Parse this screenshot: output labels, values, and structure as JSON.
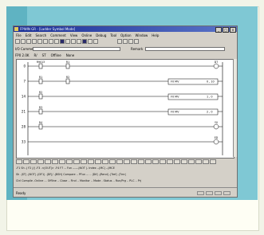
{
  "window": {
    "title": "FPWIN GR - [Ladder Symbol Mode]",
    "controls": [
      "_",
      "□",
      "×"
    ]
  },
  "menu": [
    "File",
    "Edit",
    "Search",
    "Comment",
    "View",
    "Online",
    "Debug",
    "Tool",
    "Option",
    "Window",
    "Help"
  ],
  "fields": {
    "io_comment_label": "I/O Comment",
    "remark_label": "Remark"
  },
  "status_row": [
    "FP0 2.0K",
    "R/",
    "ST",
    "Offline",
    "None"
  ],
  "ladder": {
    "rungs": [
      {
        "step": "0",
        "contacts": [
          "R9013",
          "R1"
        ],
        "coil": "DT"
      },
      {
        "step": "7",
        "contacts": [
          "R1",
          "R2"
        ],
        "instruction": "F0 MV",
        "operands": "0 , 10"
      },
      {
        "step": "14",
        "contacts": [
          "R2"
        ],
        "instruction": "F0 MV",
        "operands": "1 , 0"
      },
      {
        "step": "21",
        "contacts": [
          "R3"
        ],
        "instruction": "F0 MV",
        "operands": "2 , 0"
      },
      {
        "step": "28",
        "contacts": [
          "R4"
        ],
        "coil": "Y0"
      },
      {
        "step": "33",
        "contacts": [],
        "coil": "ED"
      }
    ]
  },
  "func_bar": {
    "keys": 28
  },
  "command_rows": [
    "-F1 Sh -| F2 |/| -F3 -<|OUT|> -F4 F7 -- Fun ------|NOT |- Index --|MC| --|MCE",
    "Sh -|ST| -|NOT| -|DF1| -|DF|/ -|BSH| Compare .. PFun ... .. |Dif| -|Rend| -|Tref| -|Tmr|",
    "Ctrl Compile -Online ... Offline .. Close .. Find .. Monitor .. Mode . Status .. Run/Prg .. PLC .. Prj"
  ],
  "statusbar": {
    "text": "Ready"
  }
}
